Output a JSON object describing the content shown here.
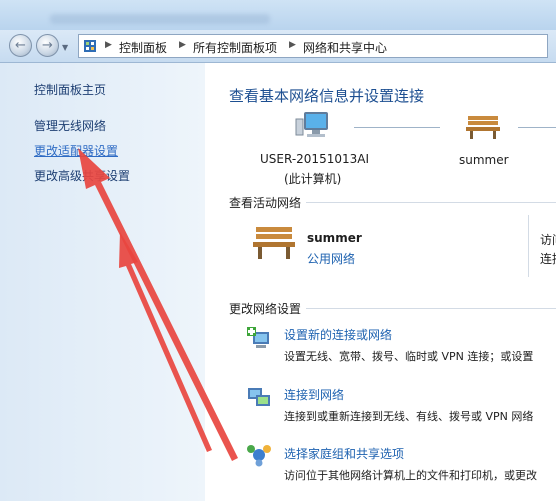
{
  "navbar": {
    "breadcrumbs": [
      "控制面板",
      "所有控制面板项",
      "网络和共享中心"
    ]
  },
  "sidebar": {
    "items": [
      {
        "label": "控制面板主页"
      },
      {
        "label": "管理无线网络"
      },
      {
        "label": "更改适配器设置"
      },
      {
        "label": "更改高级共享设置"
      }
    ]
  },
  "main": {
    "title": "查看基本网络信息并设置连接",
    "computer": {
      "name": "USER-20151013AI",
      "sub": "(此计算机)"
    },
    "network_node": "summer",
    "active_section": "查看活动网络",
    "active_network": {
      "name": "summer",
      "type": "公用网络",
      "access_label": "访问",
      "conn_label": "连接"
    },
    "settings_section": "更改网络设置",
    "tasks": [
      {
        "title": "设置新的连接或网络",
        "desc": "设置无线、宽带、拨号、临时或 VPN 连接；或设置"
      },
      {
        "title": "连接到网络",
        "desc": "连接到或重新连接到无线、有线、拨号或 VPN 网络"
      },
      {
        "title": "选择家庭组和共享选项",
        "desc": "访问位于其他网络计算机上的文件和打印机，或更改"
      }
    ]
  },
  "colors": {
    "annotation_arrow": "#e8453f",
    "link": "#1e62b0",
    "title": "#1d4f91"
  }
}
